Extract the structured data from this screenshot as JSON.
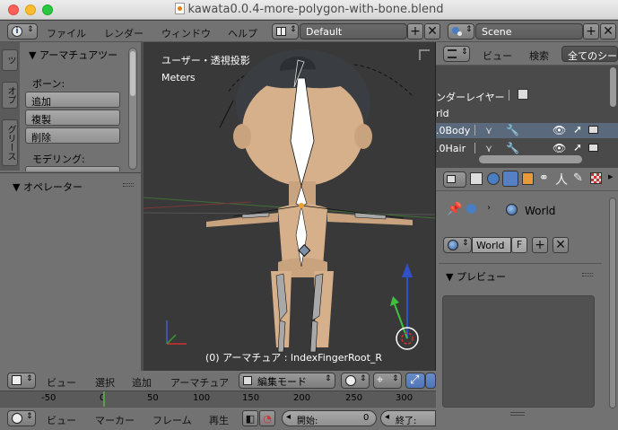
{
  "window": {
    "title": "kawata0.0.4-more-polygon-with-bone.blend"
  },
  "top_header": {
    "menus": [
      "ファイル",
      "レンダー",
      "ウィンドウ",
      "ヘルプ"
    ],
    "layout": "Default",
    "scene": "Scene"
  },
  "tool_shelf": {
    "tabs": [
      "ツ",
      "オプ",
      "グリース"
    ],
    "armature_panel": "▼ アーマチュアツー",
    "bone_label": "ボーン:",
    "buttons": [
      "追加",
      "複製",
      "削除"
    ],
    "modeling_label": "モデリング:",
    "operator_panel": "▼ オペレーター"
  },
  "viewport": {
    "view_label": "ユーザー・透視投影",
    "units": "Meters",
    "status": "(0) アーマチュア : IndexFingerRoot_R"
  },
  "viewport_header": {
    "menus": [
      "ビュー",
      "選択",
      "追加",
      "アーマチュア"
    ],
    "mode": "編集モード"
  },
  "outliner": {
    "menus": [
      "ビュー",
      "検索"
    ],
    "filter": "全てのシー",
    "rows": [
      "ンダーレイヤー",
      "rld",
      ".0Body",
      ".0Hair"
    ]
  },
  "properties": {
    "breadcrumb": "World",
    "world_name": "World",
    "fake_user": "F",
    "preview_panel": "▼ プレビュー"
  },
  "timeline": {
    "ticks": [
      "-50",
      "0",
      "50",
      "100",
      "150",
      "200",
      "250",
      "300"
    ],
    "menus": [
      "ビュー",
      "マーカー",
      "フレーム",
      "再生"
    ],
    "start_label": "開始:",
    "start_value": "0",
    "end_label": "終了:"
  },
  "colors": {
    "accent_blue": "#5680c2",
    "bone_white": "#ffffff",
    "skin": "#d5b08a",
    "hair": "#3a3d41"
  }
}
